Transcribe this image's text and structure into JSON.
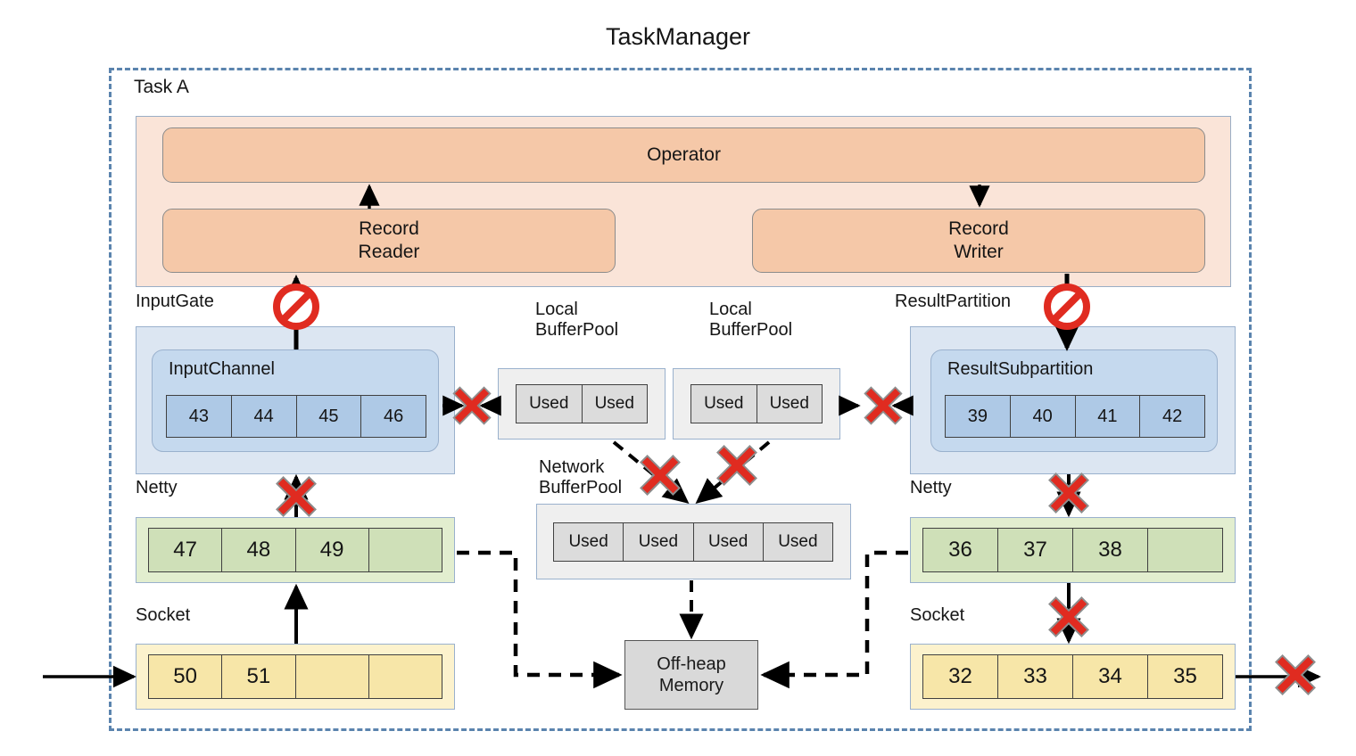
{
  "title": "TaskManager",
  "task": {
    "label": "Task A",
    "operator": "Operator",
    "record_reader": "Record\nReader",
    "record_writer": "Record\nWriter"
  },
  "labels": {
    "input_gate": "InputGate",
    "result_partition": "ResultPartition",
    "local_buffer_pool": "Local\nBufferPool",
    "network_buffer_pool": "Network\nBufferPool",
    "netty": "Netty",
    "socket": "Socket",
    "off_heap_memory": "Off-heap\nMemory"
  },
  "input_gate": {
    "channel_title": "InputChannel",
    "buffers": [
      "43",
      "44",
      "45",
      "46"
    ]
  },
  "result_partition": {
    "subpartition_title": "ResultSubpartition",
    "buffers": [
      "39",
      "40",
      "41",
      "42"
    ]
  },
  "local_buffer_pool_left": {
    "cells": [
      "Used",
      "Used"
    ]
  },
  "local_buffer_pool_right": {
    "cells": [
      "Used",
      "Used"
    ]
  },
  "network_buffer_pool": {
    "cells": [
      "Used",
      "Used",
      "Used",
      "Used"
    ]
  },
  "netty_left": {
    "cells": [
      "47",
      "48",
      "49",
      ""
    ]
  },
  "netty_right": {
    "cells": [
      "36",
      "37",
      "38",
      ""
    ]
  },
  "socket_left": {
    "cells": [
      "50",
      "51",
      "",
      ""
    ]
  },
  "socket_right": {
    "cells": [
      "32",
      "33",
      "34",
      "35"
    ]
  },
  "markers": {
    "blocked_x": "red-x-blocked-marker",
    "no_entry": "no-entry-prohibition-sign"
  },
  "colors": {
    "boundary_dashed": "#5b84ae",
    "task_background": "#fae4d8",
    "operator_fill": "#f5c8a8",
    "gate_fill": "#dce6f2",
    "channel_fill": "#c5d9ee",
    "buffer_blue": "#aec9e6",
    "netty_green": "#cfe0b8",
    "socket_yellow": "#f7e6a8",
    "pool_grey": "#dcdcdc",
    "offheap_grey": "#d9d9d9",
    "marker_red": "#e02b20",
    "arrow_black": "#000000"
  }
}
